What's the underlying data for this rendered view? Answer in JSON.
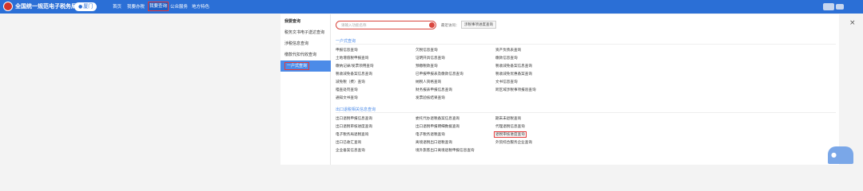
{
  "header": {
    "site_title": "全国统一规范电子税务局",
    "region": "厦门",
    "nav": [
      {
        "label": "首页",
        "active": false
      },
      {
        "label": "我要办税",
        "active": false
      },
      {
        "label": "我要查询",
        "active": true
      },
      {
        "label": "公众服务",
        "active": false
      },
      {
        "label": "地方特色",
        "active": false
      }
    ]
  },
  "sidebar": {
    "heading": "我要查询",
    "items": [
      {
        "label": "我要查询",
        "active": false
      },
      {
        "label": "税务文书电子送达查询",
        "active": false
      },
      {
        "label": "涉税信息查询",
        "active": false
      },
      {
        "label": "缴款代扣代收查询",
        "active": false
      },
      {
        "label": "一户式查询",
        "active": true
      }
    ]
  },
  "search": {
    "placeholder": "请输入功能名称",
    "hot_label": "最近访问：",
    "hot_item": "涉税事项进度查询"
  },
  "sections": [
    {
      "title": "一户式查询",
      "columns": [
        [
          "申报信息查询",
          "土地增值税申报查询",
          "缴纳记录/发票领用查询",
          "税收减免备案信息查询",
          "减免税（费）查询",
          "稽查处罚查询",
          "通知文书查询"
        ],
        [
          "欠税信息查询",
          "证明开具信息查询",
          "预缴税款查询",
          "已申报申报表及缴款信息查询",
          "纳税人资格查询",
          "财务报表申报信息查询",
          "发票验核结果查询"
        ],
        [
          "资产负债表查询",
          "缴款信息查询",
          "税收减免备案信息查询",
          "税收减免优惠备案查询",
          "文书信息查询",
          "跨区域涉税事项报验查询"
        ]
      ]
    },
    {
      "title": "出口退税相关信息查询",
      "columns": [
        [
          "出口退税申报信息查询",
          "出口退税审核进度查询",
          "电子税务局退税查询",
          "出口已收汇查询",
          "企业备案信息查询"
        ],
        [
          "委托代办退税备案信息查询",
          "出口退税申报明细数据查询",
          "电子税务退税查询",
          "离境退税出口退税查询",
          "境外旅客出口离境退税申报信息查询"
        ],
        [
          "期末未退税查询",
          "代理退税信息查询",
          "退税审核进度查询",
          "外贸综合服务企业查询"
        ]
      ]
    }
  ]
}
